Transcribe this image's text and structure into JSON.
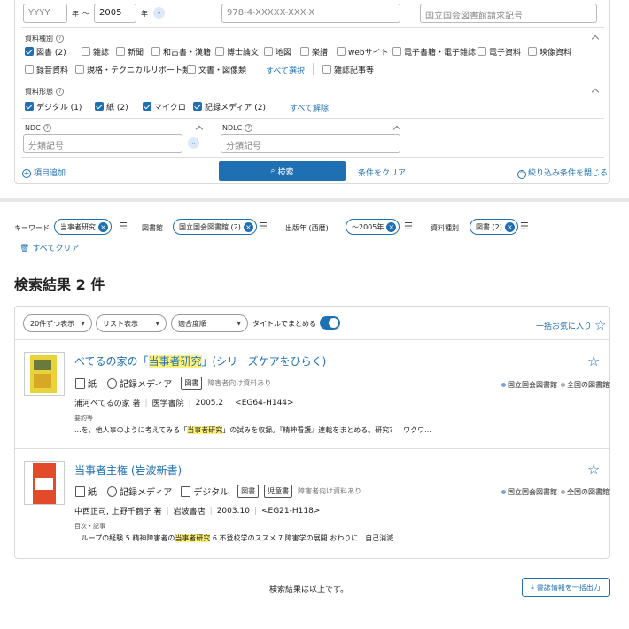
{
  "year": {
    "from_placeholder": "YYYY",
    "from_unit": "年",
    "range_sep": "〜",
    "to_value": "2005",
    "to_unit": "年"
  },
  "isbn_placeholder": "978-4-XXXXX-XXX-X",
  "callno_placeholder": "国立国会図書館請求記号",
  "material_type": {
    "label": "資料種別",
    "items": [
      {
        "label": "図書 (2)",
        "checked": true
      },
      {
        "label": "雑誌",
        "checked": false
      },
      {
        "label": "新聞",
        "checked": false
      },
      {
        "label": "和古書・漢籍",
        "checked": false
      },
      {
        "label": "博士論文",
        "checked": false
      },
      {
        "label": "地図",
        "checked": false
      },
      {
        "label": "楽譜",
        "checked": false
      },
      {
        "label": "webサイト",
        "checked": false
      },
      {
        "label": "電子書籍・電子雑誌",
        "checked": false
      },
      {
        "label": "電子資料",
        "checked": false
      },
      {
        "label": "映像資料",
        "checked": false
      },
      {
        "label": "録音資料",
        "checked": false
      },
      {
        "label": "規格・テクニカルリポート類",
        "checked": false
      },
      {
        "label": "文書・図像類",
        "checked": false
      },
      {
        "label": "雑誌記事等",
        "checked": false
      }
    ],
    "select_all": "すべて選択"
  },
  "material_form": {
    "label": "資料形態",
    "items": [
      {
        "label": "デジタル (1)",
        "checked": true
      },
      {
        "label": "紙 (2)",
        "checked": true
      },
      {
        "label": "マイクロ",
        "checked": true
      },
      {
        "label": "記録メディア (2)",
        "checked": true
      }
    ],
    "deselect_all": "すべて解除"
  },
  "ndc": {
    "label": "NDC",
    "placeholder": "分類記号"
  },
  "ndlc": {
    "label": "NDLC",
    "placeholder": "分類記号"
  },
  "add_field": "項目追加",
  "search_button": "検索",
  "clear_button": "条件をクリア",
  "close_filters": "絞り込み条件を閉じる",
  "filters": {
    "keyword_label": "キーワード",
    "keyword_value": "当事者研究",
    "library_label": "図書館",
    "library_value": "国立国会図書館 (2)",
    "year_label": "出版年 (西暦)",
    "year_value": "〜2005年",
    "type_label": "資料種別",
    "type_value": "図書 (2)",
    "clear_all": "すべてクリア"
  },
  "results": {
    "heading": "検索結果 2 件",
    "per_page": "20件ずつ表示",
    "view_mode": "リスト表示",
    "sort": "適合度順",
    "group_title_label": "タイトルでまとめる",
    "bookmark_all": "一括お気に入り",
    "end_message": "検索結果は以上です。",
    "export_button": "書誌情報を一括出力",
    "items": [
      {
        "title_pre": "べてるの家の「",
        "title_hl": "当事者研究",
        "title_post": "」(シリーズケアをひらく)",
        "media": [
          "紙",
          "記録メディア"
        ],
        "tags": [
          "図書"
        ],
        "accessibility": "障害者向け資料あり",
        "holdings": [
          "国立国会図書館",
          "全国の図書館"
        ],
        "author": "浦河べてるの家 著",
        "publisher": "医学書院",
        "date": "2005.2",
        "callno": "<EG64-H144>",
        "snippet_label": "要約等",
        "snippet_pre": "...を、他人事のように考えてみる「",
        "snippet_hl": "当事者研究",
        "snippet_post": "」の試みを収録。『精神看護』連載をまとめる。研究？　ワクワ..."
      },
      {
        "title_pre": "当事者主権 (岩波新書)",
        "title_hl": "",
        "title_post": "",
        "media": [
          "紙",
          "記録メディア",
          "デジタル"
        ],
        "tags": [
          "図書",
          "児童書"
        ],
        "accessibility": "障害者向け資料あり",
        "holdings": [
          "国立国会図書館",
          "全国の図書館"
        ],
        "author": "中西正司, 上野千鶴子 著",
        "publisher": "岩波書店",
        "date": "2003.10",
        "callno": "<EG21-H118>",
        "snippet_label": "目次・記事",
        "snippet_pre": "...ループの経験 5 精神障害者の",
        "snippet_hl": "当事者研究",
        "snippet_post": " 6 不登校学のススメ 7 障害学の展開 おわりに　自己消滅..."
      }
    ]
  },
  "colors": {
    "accent": "#1f6fb3",
    "highlight": "#fff27a"
  }
}
